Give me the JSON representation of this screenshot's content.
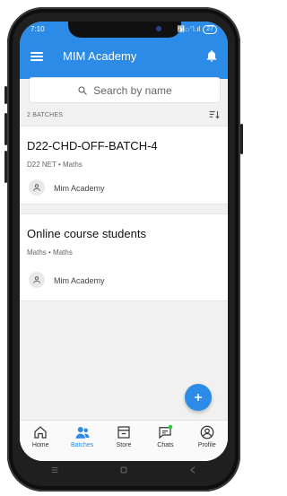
{
  "status_bar": {
    "time": "7:10",
    "signal": "௡ி.ıl",
    "battery": "27"
  },
  "app_bar": {
    "title": "MIM Academy"
  },
  "search": {
    "placeholder": "Search by name"
  },
  "batches": {
    "count_label": "2 BATCHES",
    "items": [
      {
        "name": "D22-CHD-OFF-BATCH-4",
        "subtitle": "D22 NET • Maths",
        "owner": "Mim Academy"
      },
      {
        "name": "Online course students",
        "subtitle": "Maths • Maths",
        "owner": "Mim Academy"
      }
    ]
  },
  "bottom_nav": {
    "items": [
      {
        "label": "Home"
      },
      {
        "label": "Batches"
      },
      {
        "label": "Store"
      },
      {
        "label": "Chats"
      },
      {
        "label": "Profile"
      }
    ],
    "active_index": 1
  },
  "colors": {
    "accent": "#2b8be6",
    "chat_badge": "#2ecc40"
  }
}
